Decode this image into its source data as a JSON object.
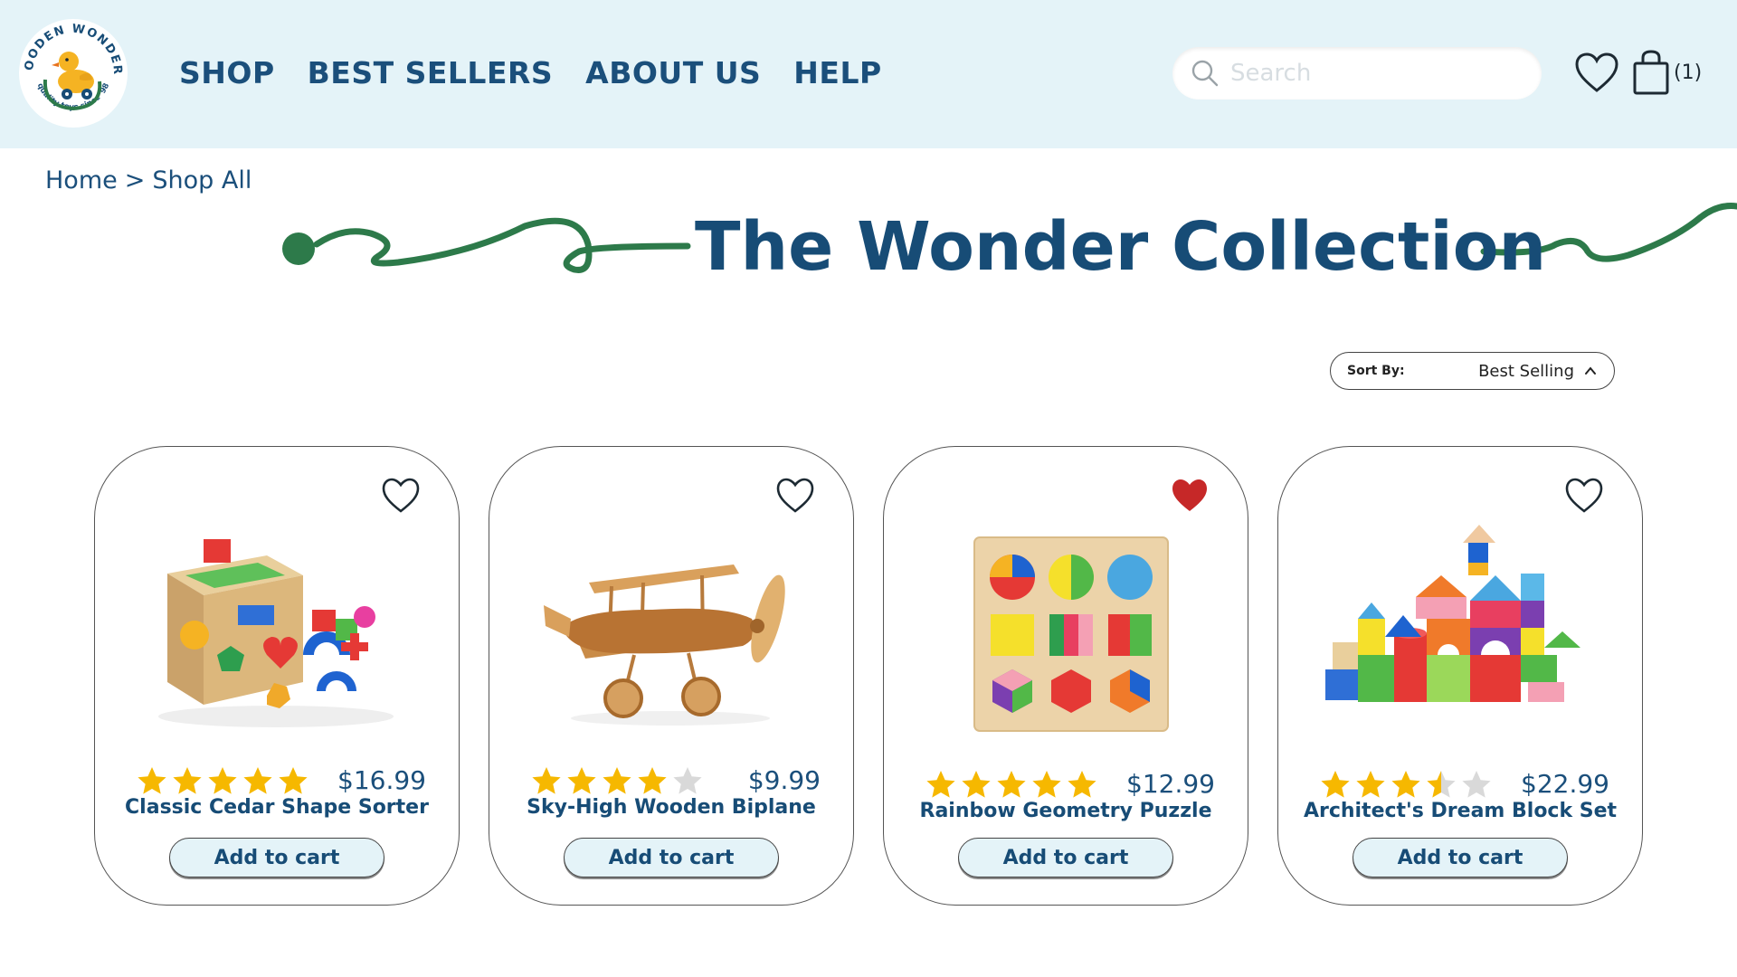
{
  "brand": {
    "logo_text_top": "WOODEN WONDERS",
    "logo_text_bottom": "quality toys since '98"
  },
  "nav": {
    "items": [
      {
        "label": "SHOP"
      },
      {
        "label": "BEST SELLERS"
      },
      {
        "label": "ABOUT US"
      },
      {
        "label": "HELP"
      }
    ]
  },
  "search": {
    "placeholder": "Search",
    "value": ""
  },
  "cart": {
    "count_label": "(1)"
  },
  "breadcrumb": {
    "home": "Home",
    "separator": ">",
    "current": "Shop All"
  },
  "page": {
    "title": "The Wonder Collection"
  },
  "sort": {
    "label": "Sort By:",
    "value": "Best Selling"
  },
  "colors": {
    "header_bg": "#e4f3f8",
    "brand_blue": "#174c76",
    "squiggle_green": "#2d7a4a",
    "star_gold": "#f6b800",
    "star_empty": "#d9d9d9",
    "heart_red": "#c62828"
  },
  "products": [
    {
      "name": "Classic Cedar Shape Sorter",
      "price": "$16.99",
      "rating": 5,
      "favorited": false,
      "button": "Add to cart",
      "image": "shape-sorter-cube"
    },
    {
      "name": "Sky-High Wooden Biplane",
      "price": "$9.99",
      "rating": 4,
      "favorited": false,
      "button": "Add to cart",
      "image": "wooden-biplane"
    },
    {
      "name": "Rainbow Geometry Puzzle",
      "price": "$12.99",
      "rating": 5,
      "favorited": true,
      "button": "Add to cart",
      "image": "geometry-puzzle-board"
    },
    {
      "name": "Architect's Dream Block Set",
      "price": "$22.99",
      "rating": 3.5,
      "favorited": false,
      "button": "Add to cart",
      "image": "block-castle"
    }
  ]
}
